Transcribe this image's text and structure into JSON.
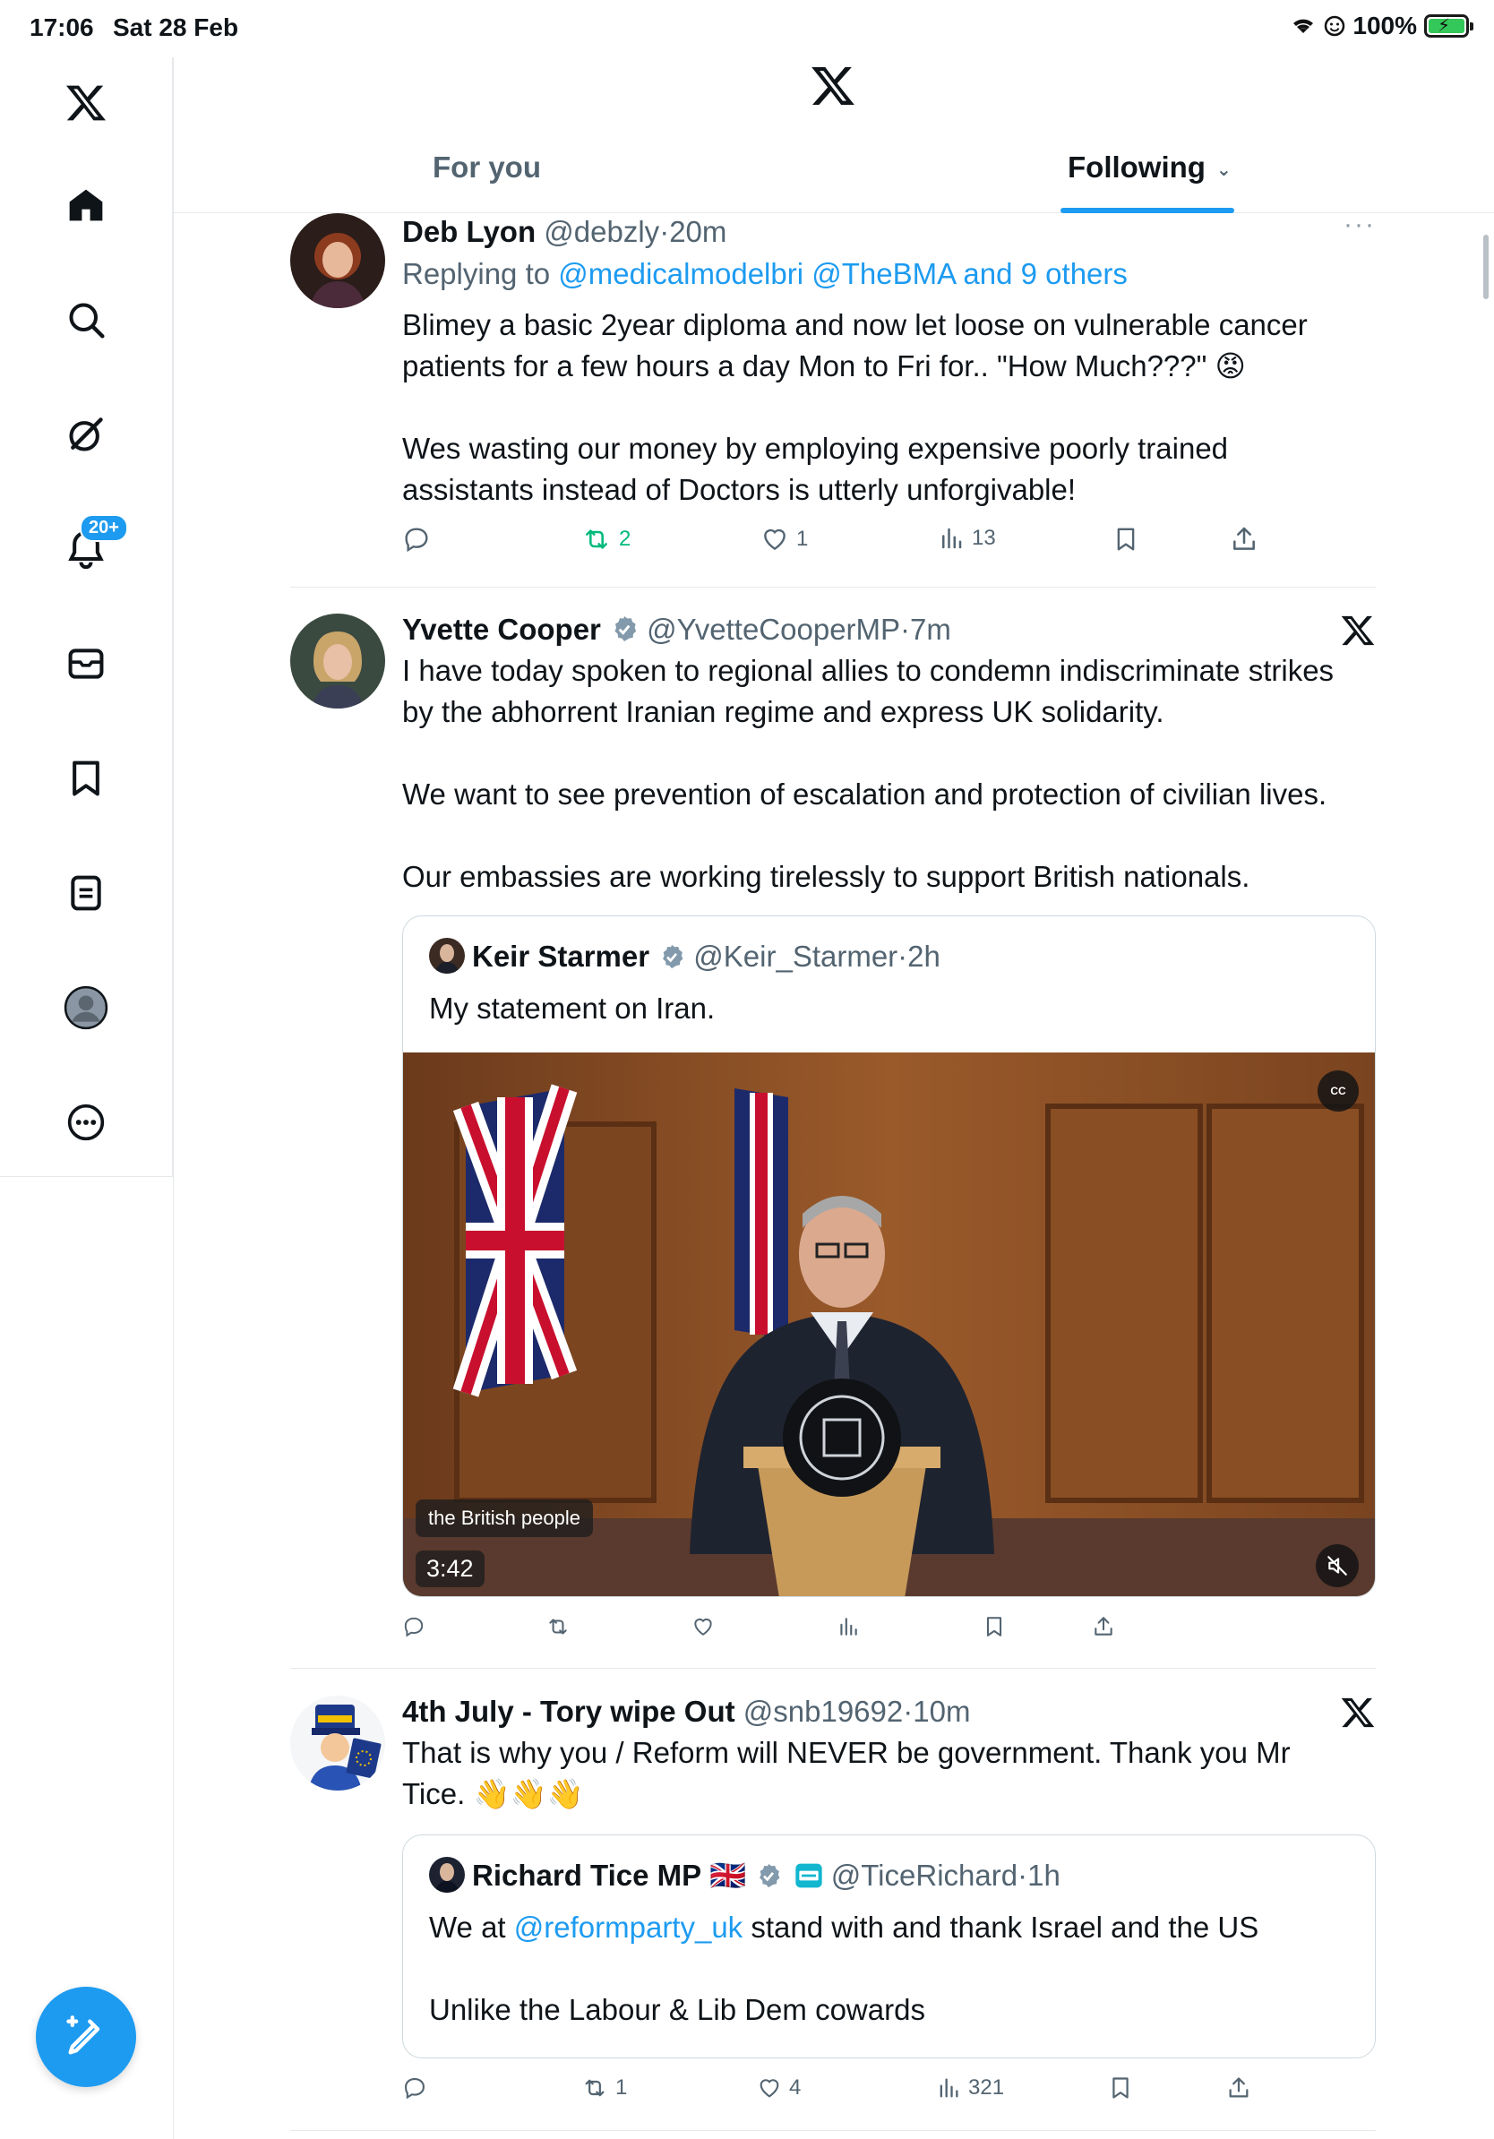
{
  "status_bar": {
    "time": "17:06",
    "date": "Sat 28 Feb",
    "battery": "100%"
  },
  "sidebar": {
    "notifications_badge": "20+",
    "items": [
      {
        "name": "home"
      },
      {
        "name": "explore"
      },
      {
        "name": "grok"
      },
      {
        "name": "notifications"
      },
      {
        "name": "messages"
      },
      {
        "name": "bookmarks"
      },
      {
        "name": "lists"
      },
      {
        "name": "profile"
      },
      {
        "name": "more"
      }
    ]
  },
  "tabs": [
    {
      "label": "For you"
    },
    {
      "label": "Following"
    }
  ],
  "tweets": [
    {
      "name": "Deb Lyon",
      "handle": "@debzly",
      "sep": "·",
      "time": "20m",
      "replying_prefix": "Replying to",
      "replying_targets": "@medicalmodelbri @TheBMA and 9 others",
      "text": "Blimey a basic 2year diploma and now let loose on vulnerable cancer\npatients for a few hours a day Mon to Fri for.. \"How Much???\" 😡\n\nWes wasting our money by employing expensive poorly trained\nassistants instead of Doctors is utterly unforgivable!",
      "more": "···",
      "stats": {
        "replies": "",
        "reposts": "2",
        "likes": "1",
        "views": "13"
      }
    },
    {
      "name": "Yvette Cooper",
      "handle": "@YvetteCooperMP",
      "sep": "·",
      "time": "7m",
      "text": "I have today spoken to regional allies to condemn indiscriminate strikes\nby the abhorrent Iranian regime and express UK solidarity.\n\nWe want to see prevention of escalation and protection of civilian lives.\n\nOur embassies are working tirelessly to support British nationals.",
      "quote": {
        "name": "Keir Starmer",
        "handle": "@Keir_Starmer",
        "sep": "·",
        "time": "2h",
        "text": "My statement on Iran.",
        "video": {
          "cc": "CC",
          "caption": "the British people",
          "duration": "3:42"
        }
      }
    },
    {
      "name": "4th July - Tory wipe Out",
      "handle": "@snb19692",
      "sep": "·",
      "time": "10m",
      "text": "That is why you / Reform will NEVER be government. Thank you Mr\nTice. 👋👋👋",
      "quote": {
        "name": "Richard Tice MP",
        "flag": "🇬🇧",
        "handle": "@TiceRichard",
        "sep": "·",
        "time": "1h",
        "text_prefix": "We at ",
        "mention": "@reformparty_uk",
        "text_suffix": " stand with and thank Israel and the US",
        "text2": "Unlike the Labour & Lib Dem cowards"
      },
      "stats": {
        "replies": "",
        "reposts": "1",
        "likes": "4",
        "views": "321"
      }
    }
  ]
}
